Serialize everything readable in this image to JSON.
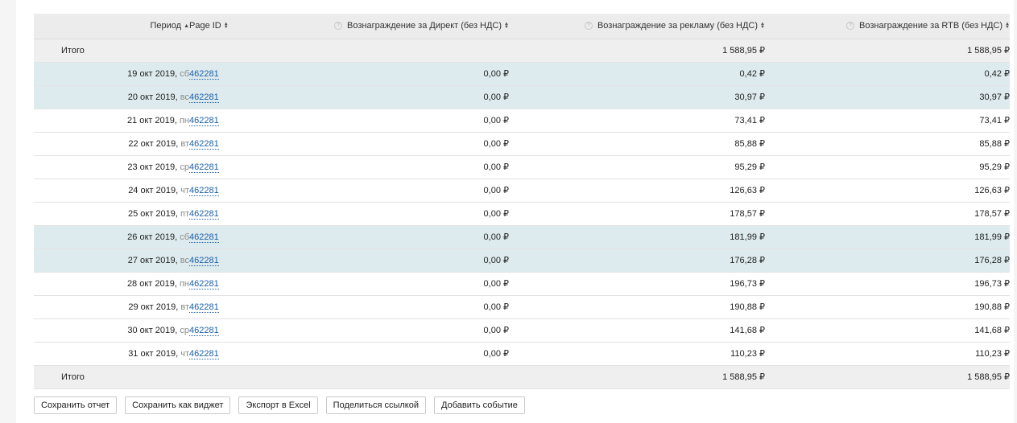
{
  "columns": {
    "period": "Период",
    "page_id": "Page ID",
    "direct": "Вознаграждение за Директ (без НДС)",
    "ads": "Вознаграждение за рекламу (без НДС)",
    "rtb": "Вознаграждение за RTB (без НДС)"
  },
  "sort_icons": {
    "asc": "▲",
    "both_up": "▲",
    "both_down": "▼",
    "help": "?"
  },
  "total_top": {
    "label": "Итого",
    "direct": "",
    "ads": "1 588,95 ₽",
    "rtb": "1 588,95 ₽"
  },
  "rows": [
    {
      "date": "19 окт 2019,",
      "dow": "сб",
      "page_id": "462281",
      "direct": "0,00 ₽",
      "ads": "0,42 ₽",
      "rtb": "0,42 ₽",
      "weekend": true
    },
    {
      "date": "20 окт 2019,",
      "dow": "вс",
      "page_id": "462281",
      "direct": "0,00 ₽",
      "ads": "30,97 ₽",
      "rtb": "30,97 ₽",
      "weekend": true
    },
    {
      "date": "21 окт 2019,",
      "dow": "пн",
      "page_id": "462281",
      "direct": "0,00 ₽",
      "ads": "73,41 ₽",
      "rtb": "73,41 ₽",
      "weekend": false
    },
    {
      "date": "22 окт 2019,",
      "dow": "вт",
      "page_id": "462281",
      "direct": "0,00 ₽",
      "ads": "85,88 ₽",
      "rtb": "85,88 ₽",
      "weekend": false
    },
    {
      "date": "23 окт 2019,",
      "dow": "ср",
      "page_id": "462281",
      "direct": "0,00 ₽",
      "ads": "95,29 ₽",
      "rtb": "95,29 ₽",
      "weekend": false
    },
    {
      "date": "24 окт 2019,",
      "dow": "чт",
      "page_id": "462281",
      "direct": "0,00 ₽",
      "ads": "126,63 ₽",
      "rtb": "126,63 ₽",
      "weekend": false
    },
    {
      "date": "25 окт 2019,",
      "dow": "пт",
      "page_id": "462281",
      "direct": "0,00 ₽",
      "ads": "178,57 ₽",
      "rtb": "178,57 ₽",
      "weekend": false
    },
    {
      "date": "26 окт 2019,",
      "dow": "сб",
      "page_id": "462281",
      "direct": "0,00 ₽",
      "ads": "181,99 ₽",
      "rtb": "181,99 ₽",
      "weekend": true
    },
    {
      "date": "27 окт 2019,",
      "dow": "вс",
      "page_id": "462281",
      "direct": "0,00 ₽",
      "ads": "176,28 ₽",
      "rtb": "176,28 ₽",
      "weekend": true
    },
    {
      "date": "28 окт 2019,",
      "dow": "пн",
      "page_id": "462281",
      "direct": "0,00 ₽",
      "ads": "196,73 ₽",
      "rtb": "196,73 ₽",
      "weekend": false
    },
    {
      "date": "29 окт 2019,",
      "dow": "вт",
      "page_id": "462281",
      "direct": "0,00 ₽",
      "ads": "190,88 ₽",
      "rtb": "190,88 ₽",
      "weekend": false
    },
    {
      "date": "30 окт 2019,",
      "dow": "ср",
      "page_id": "462281",
      "direct": "0,00 ₽",
      "ads": "141,68 ₽",
      "rtb": "141,68 ₽",
      "weekend": false
    },
    {
      "date": "31 окт 2019,",
      "dow": "чт",
      "page_id": "462281",
      "direct": "0,00 ₽",
      "ads": "110,23 ₽",
      "rtb": "110,23 ₽",
      "weekend": false
    }
  ],
  "total_bottom": {
    "label": "Итого",
    "direct": "",
    "ads": "1 588,95 ₽",
    "rtb": "1 588,95 ₽"
  },
  "actions": {
    "save_report": "Сохранить отчет",
    "save_widget": "Сохранить как виджет",
    "export_excel": "Экспорт в Excel",
    "share_link": "Поделиться ссылкой",
    "add_event": "Добавить событие"
  },
  "colors": {
    "header_bg": "#ececec",
    "total_bg": "#efefef",
    "weekend_bg": "#deebee",
    "link": "#1a5fa8"
  }
}
